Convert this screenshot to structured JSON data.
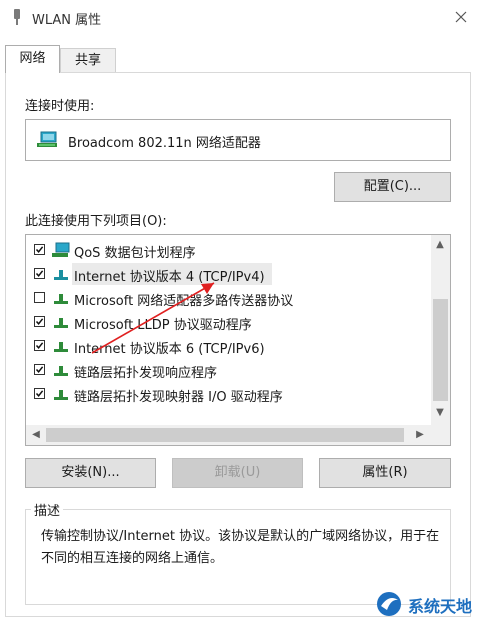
{
  "window": {
    "title": "WLAN 属性"
  },
  "tabs": [
    {
      "label": "网络",
      "active": true
    },
    {
      "label": "共享",
      "active": false
    }
  ],
  "connect_using_label": "连接时使用:",
  "adapter": {
    "name": "Broadcom 802.11n 网络适配器",
    "icon": "network-adapter-icon"
  },
  "configure_button": "配置(C)...",
  "items_label": "此连接使用下列项目(O):",
  "items": [
    {
      "label": "QoS 数据包计划程序",
      "checked": true,
      "icon": "qos-icon"
    },
    {
      "label": "Internet 协议版本 4 (TCP/IPv4)",
      "checked": true,
      "icon": "protocol-icon",
      "selected": true
    },
    {
      "label": "Microsoft 网络适配器多路传送器协议",
      "checked": false,
      "icon": "protocol-icon"
    },
    {
      "label": "Microsoft LLDP 协议驱动程序",
      "checked": true,
      "icon": "protocol-icon"
    },
    {
      "label": "Internet 协议版本 6 (TCP/IPv6)",
      "checked": true,
      "icon": "protocol-icon"
    },
    {
      "label": "链路层拓扑发现响应程序",
      "checked": true,
      "icon": "protocol-icon"
    },
    {
      "label": "链路层拓扑发现映射器 I/O 驱动程序",
      "checked": true,
      "icon": "protocol-icon"
    }
  ],
  "buttons": {
    "install": "安装(N)...",
    "uninstall": "卸载(U)",
    "properties": "属性(R)"
  },
  "description": {
    "legend": "描述",
    "text": "传输控制协议/Internet 协议。该协议是默认的广域网络协议，用于在不同的相互连接的网络上通信。"
  },
  "watermark": {
    "text": "系统天地"
  },
  "colors": {
    "annotation_arrow": "#e02020",
    "icon_green": "#2e8b3a",
    "icon_teal": "#1a8fa0",
    "watermark_blue": "#1e6fbf"
  }
}
